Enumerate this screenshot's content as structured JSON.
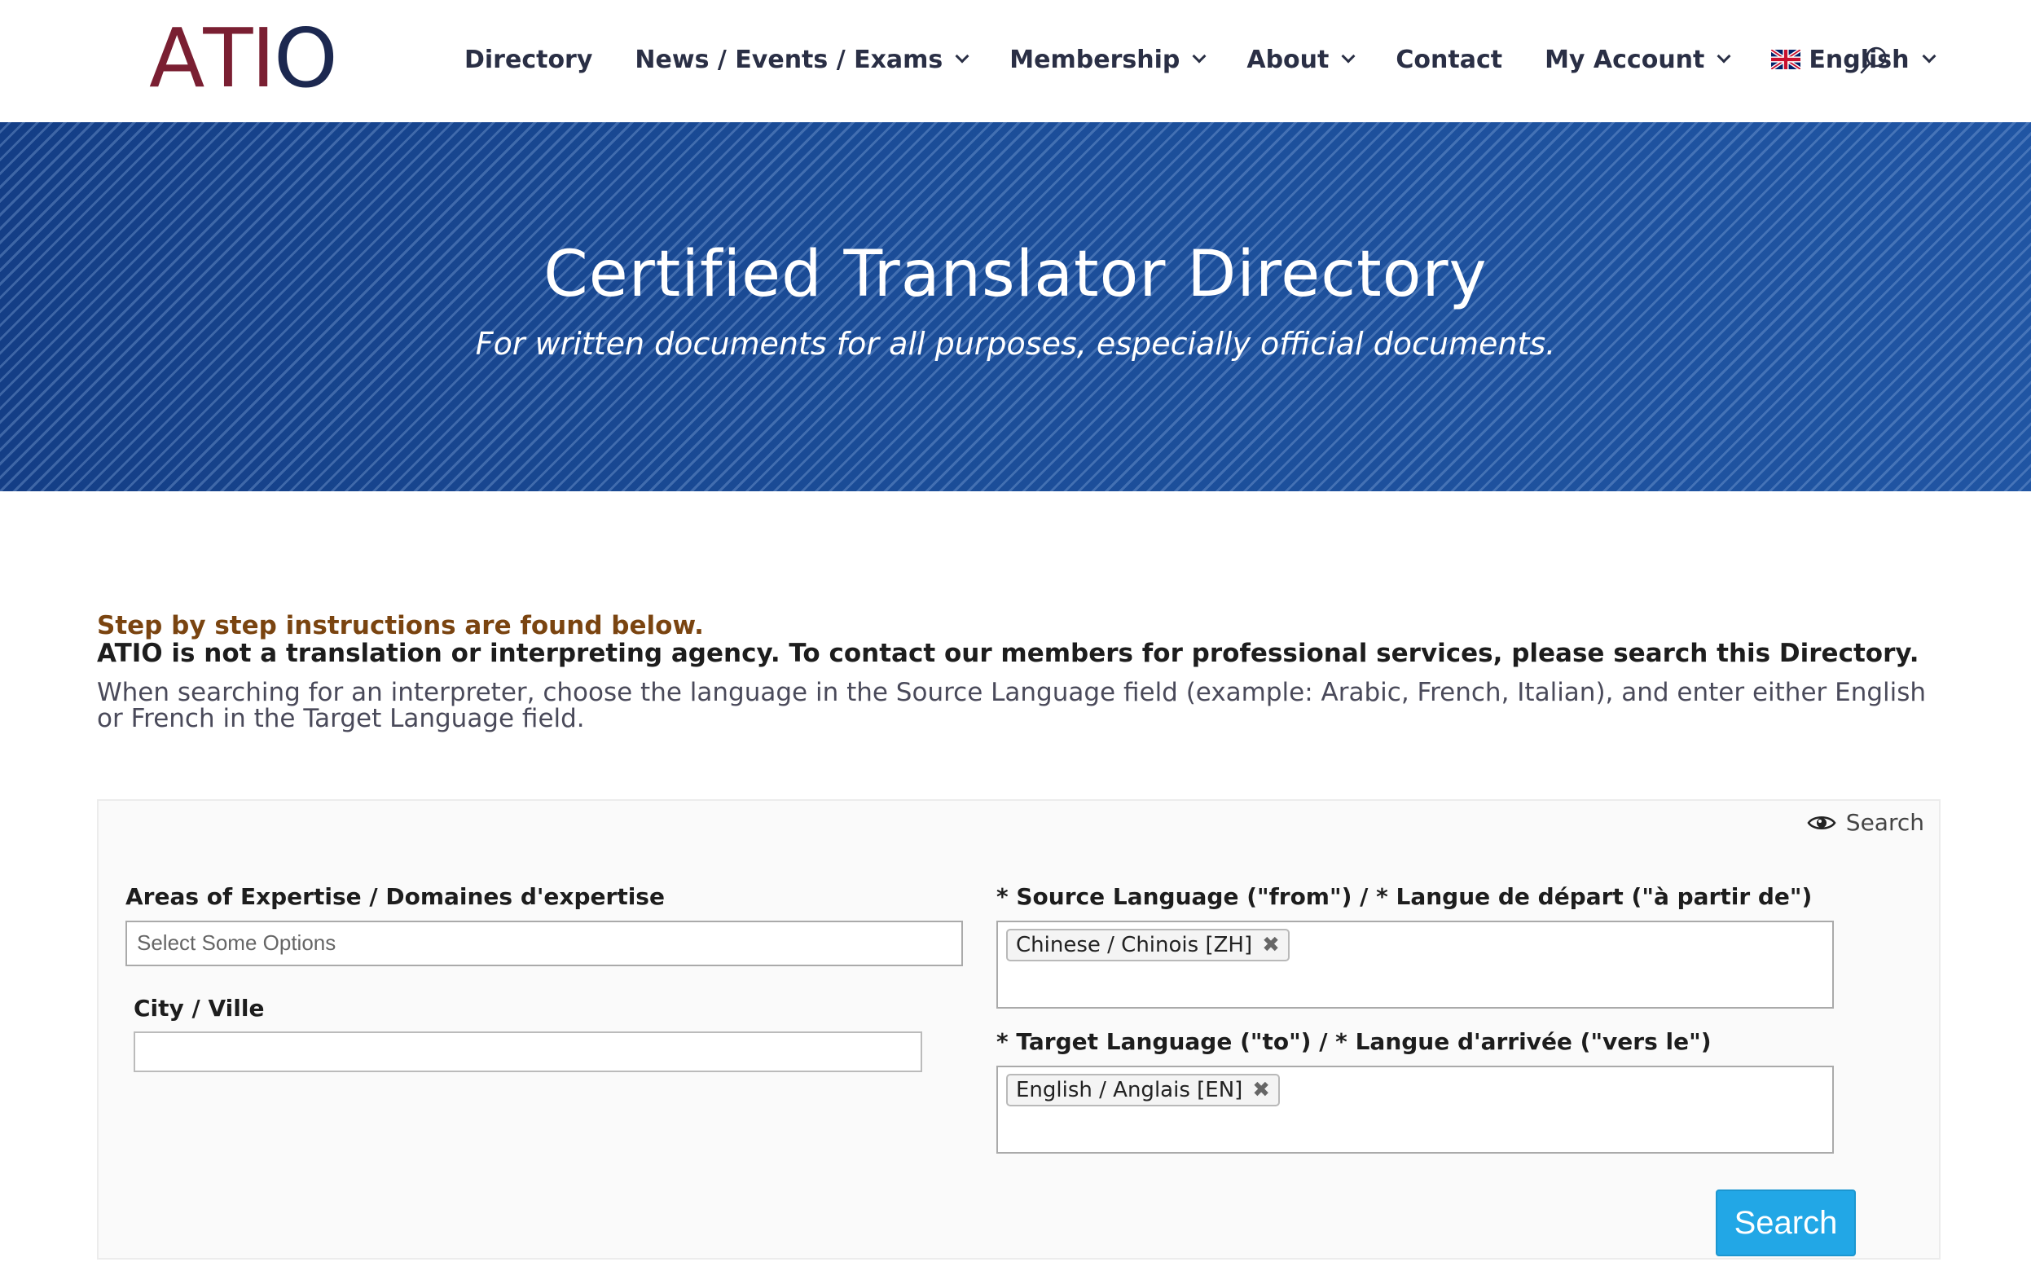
{
  "header": {
    "logo": {
      "letters": [
        "A",
        "T",
        "I",
        "O"
      ],
      "colors": {
        "primary": "#7a1f32",
        "accent": "#1c2850"
      }
    },
    "nav": [
      {
        "label": "Directory",
        "dropdown": false
      },
      {
        "label": "News / Events / Exams",
        "dropdown": true
      },
      {
        "label": "Membership",
        "dropdown": true
      },
      {
        "label": "About",
        "dropdown": true
      },
      {
        "label": "Contact",
        "dropdown": false
      },
      {
        "label": "My Account",
        "dropdown": true
      },
      {
        "label": "English",
        "dropdown": true,
        "icon": "uk-flag-icon"
      }
    ],
    "search_icon": "search-icon"
  },
  "hero": {
    "title": "Certified Translator Directory",
    "subtitle": "For written documents for all purposes, especially official documents.",
    "background_color": "#1a4a93"
  },
  "intro": {
    "step_text": "Step by step instructions are found below.",
    "agency_text": "ATIO is not a translation or interpreting agency. To contact our members for professional services, please search this Directory.",
    "description": "When searching for an interpreter, choose the language in the Source Language field (example: Arabic, French, Italian), and enter either English or French in the Target Language field."
  },
  "search_panel": {
    "toggle_label": "Search",
    "toggle_icon": "eye-icon",
    "expertise": {
      "label": "Areas of Expertise / Domaines d'expertise",
      "placeholder": "Select Some Options"
    },
    "city": {
      "label": "City / Ville",
      "value": ""
    },
    "source_language": {
      "label": "* Source Language (\"from\") / * Langue de départ (\"à partir de\")",
      "selected": [
        "Chinese / Chinois [ZH]"
      ]
    },
    "target_language": {
      "label": "* Target Language (\"to\") / * Langue d'arrivée (\"vers le\")",
      "selected": [
        "English / Anglais [EN]"
      ]
    },
    "remove_symbol": "✖",
    "submit_label": "Search",
    "submit_color": "#22a7e6"
  }
}
